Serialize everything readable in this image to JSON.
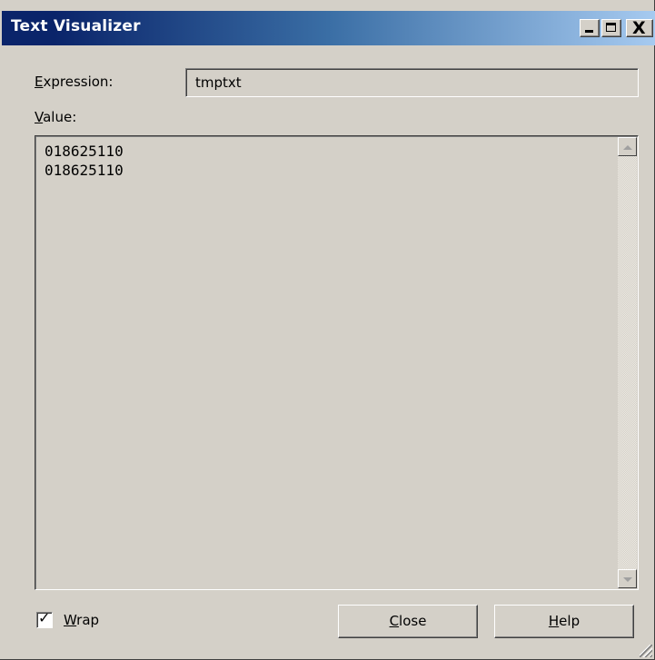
{
  "window": {
    "title": "Text Visualizer",
    "controls": {
      "minimize_glyph": "_",
      "maximize_glyph": "□",
      "close_glyph": "X"
    }
  },
  "expression": {
    "label_mnemonic": "E",
    "label_rest": "xpression:",
    "value": "tmptxt"
  },
  "value_section": {
    "label_mnemonic": "V",
    "label_rest": "alue:",
    "text": "018625110\n018625110"
  },
  "wrap": {
    "label_mnemonic": "W",
    "label_rest": "rap",
    "checked": true,
    "check_glyph": "✓"
  },
  "buttons": {
    "close": {
      "mnemonic": "C",
      "rest": "lose"
    },
    "help": {
      "mnemonic": "H",
      "rest": "elp"
    }
  },
  "icons": {
    "scroll_up": "scroll-up-arrow-icon",
    "scroll_down": "scroll-down-arrow-icon",
    "resize_grip": "resize-grip-icon"
  }
}
